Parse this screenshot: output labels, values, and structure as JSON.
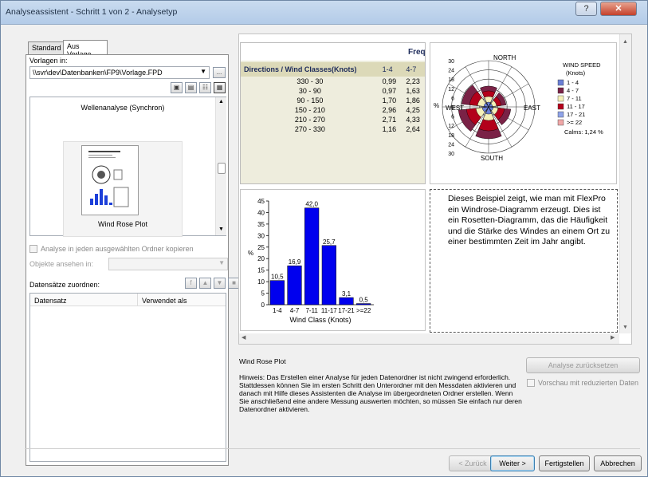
{
  "window": {
    "title": "Analyseassistent - Schritt 1 von 2 - Analysetyp",
    "help_label": "?",
    "close_label": "✕"
  },
  "tabs": [
    {
      "label": "Standard"
    },
    {
      "label": "Aus Vorlage"
    }
  ],
  "templates": {
    "label": "Vorlagen in:",
    "path": "\\\\svr\\dev\\Datenbanken\\FP9\\Vorlage.FPD",
    "browse_label": "...",
    "preview_title": "Wellenanalyse (Synchron)",
    "selected_name": "Wind Rose Plot"
  },
  "options": {
    "copy_label": "Analyse in jeden ausgewählten Ordner kopieren",
    "objects_label": "Objekte ansehen in:",
    "assign_label": "Datensätze zuordnen:"
  },
  "dataset_table": {
    "headers": [
      "Datensatz",
      "Verwendet als"
    ]
  },
  "freq_table": {
    "title": "Frequ",
    "header": "Directions / Wind Classes(Knots)",
    "col_headers": [
      "1-4",
      "4-7"
    ],
    "rows": [
      {
        "dir": "330 - 30",
        "v1": "0,99",
        "v2": "2,23"
      },
      {
        "dir": "30 - 90",
        "v1": "0,97",
        "v2": "1,63"
      },
      {
        "dir": "90 - 150",
        "v1": "1,70",
        "v2": "1,86"
      },
      {
        "dir": "150 - 210",
        "v1": "2,96",
        "v2": "4,25"
      },
      {
        "dir": "210 - 270",
        "v1": "2,71",
        "v2": "4,33"
      },
      {
        "dir": "270 - 330",
        "v1": "1,16",
        "v2": "2,64"
      }
    ]
  },
  "windrose": {
    "north": "NORTH",
    "south": "SOUTH",
    "east": "EAST",
    "west": "WEST",
    "percent": "%",
    "ticks": [
      "30",
      "24",
      "18",
      "12",
      "6",
      "0",
      "6",
      "12",
      "18",
      "24",
      "30"
    ],
    "legend_title": "WIND SPEED",
    "legend_unit": "(Knots)",
    "legend": [
      {
        "label": "1 - 4",
        "color": "#6a7fd6"
      },
      {
        "label": "4 - 7",
        "color": "#7a2246"
      },
      {
        "label": "7 - 11",
        "color": "#f5f0b8"
      },
      {
        "label": "11 - 17",
        "color": "#b3001b"
      },
      {
        "label": "17 - 21",
        "color": "#8fa3e8"
      },
      {
        "label": ">= 22",
        "color": "#f0a8a8"
      }
    ],
    "calms": "Calms: 1,24 %"
  },
  "chart_data": {
    "type": "bar",
    "categories": [
      "1-4",
      "4-7",
      "7-11",
      "11-17",
      "17-21",
      ">=22"
    ],
    "values": [
      10.5,
      16.9,
      42.0,
      25.7,
      3.1,
      0.5
    ],
    "value_labels": [
      "10,5",
      "16,9",
      "42,0",
      "25,7",
      "3,1",
      "0,5"
    ],
    "xlabel": "Wind Class (Knots)",
    "ylabel": "%",
    "ylim": [
      0,
      45
    ],
    "yticks": [
      "0",
      "5",
      "10",
      "15",
      "20",
      "25",
      "30",
      "35",
      "40",
      "45"
    ],
    "color": "#0000ee"
  },
  "description": "Dieses Beispiel zeigt, wie man mit FlexPro ein Windrose-Diagramm erzeugt. Dies ist ein Rosetten-Diagramm, das die Häufigkeit und die Stärke des Windes an einem Ort zu einer bestimmten Zeit im Jahr angibt.",
  "info": {
    "title": "Wind Rose Plot",
    "hint": "Hinweis: Das Erstellen einer Analyse für jeden Datenordner ist nicht zwingend erforderlich. Stattdessen können Sie im ersten Schritt den Unterordner mit den Messdaten aktivieren und danach mit Hilfe dieses Assistenten die Analyse im übergeordneten Ordner erstellen. Wenn Sie anschließend eine andere Messung auswerten möchten, so müssen Sie einfach nur deren Datenordner aktivieren."
  },
  "right_controls": {
    "reset_label": "Analyse zurücksetzen",
    "preview_label": "Vorschau mit reduzierten Daten"
  },
  "footer": {
    "back": "< Zurück",
    "next": "Weiter >",
    "finish": "Fertigstellen",
    "cancel": "Abbrechen"
  }
}
